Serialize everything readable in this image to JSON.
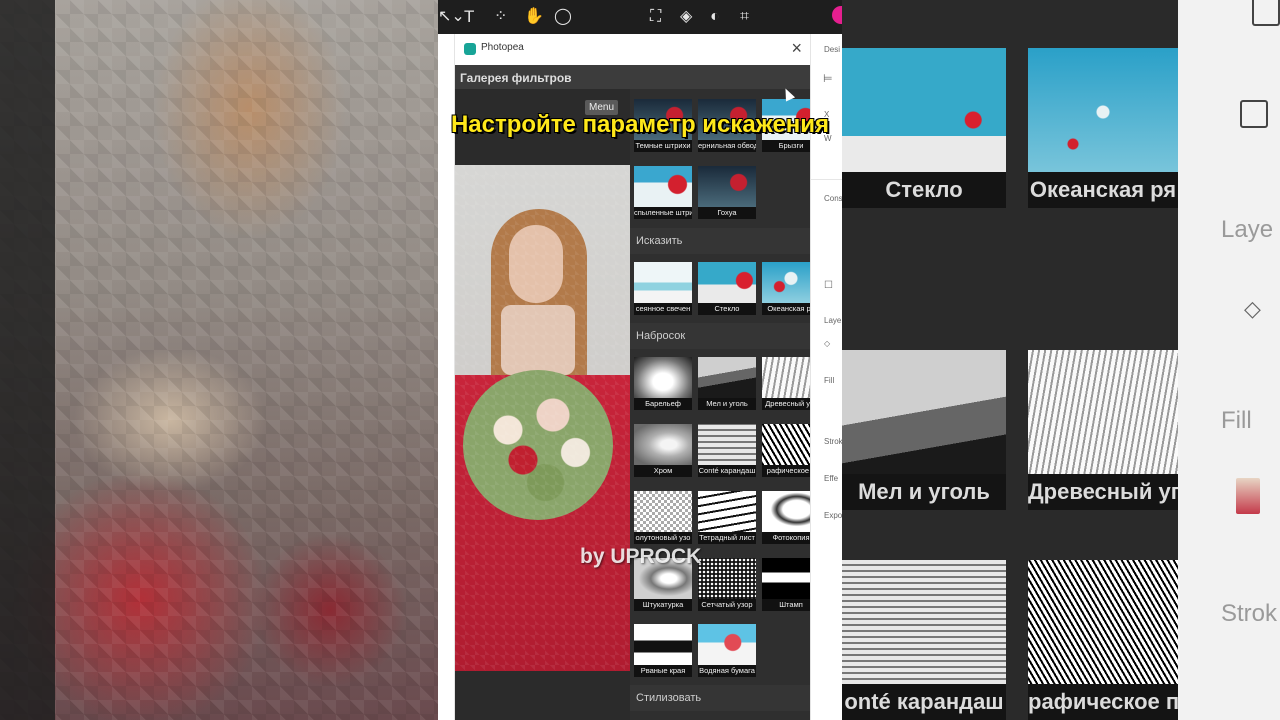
{
  "toolbar": {
    "icons": [
      "move-icon",
      "text-icon",
      "components-icon",
      "hand-icon",
      "comment-icon",
      "frame-icon",
      "component-icon",
      "contrast-icon",
      "crop-icon"
    ],
    "text_glyph": "T"
  },
  "photopea": {
    "title": "Photopea",
    "close": "×"
  },
  "gallery": {
    "title": "Галерея фильтров",
    "menu_label": "Menu",
    "sections": {
      "distort": "Исказить",
      "sketch": "Набросок",
      "stylize": "Стилизовать"
    },
    "filters_top": [
      "Темные штрихи",
      "ернильная обвод",
      "Брызги",
      "спыленные штри",
      "Гохуа"
    ],
    "filters_distort": [
      "сеянное свечен",
      "Стекло",
      "Океанская ря"
    ],
    "filters_sketch": [
      "Барельеф",
      "Мел и уголь",
      "Древесный уго",
      "Хром",
      "Conté карандаш",
      "рафическое п",
      "олутоновый узо",
      "Тетрадный лист",
      "Фотокопия",
      "Штукатурка",
      "Сетчатый узор",
      "Штамп",
      "Рваные края",
      "Водяная бумага"
    ]
  },
  "overlay": {
    "caption": "Настройте параметр искажения",
    "watermark": "by UPROCK"
  },
  "right_bg": {
    "labels": [
      "Стекло",
      "Океанская ря",
      "Мел и уголь",
      "Древесный уг",
      "onté карандаш",
      "рафическое п"
    ],
    "panel_labels": [
      "Laye",
      "Fill",
      "Strok"
    ]
  },
  "right_panel": {
    "labels": [
      "Desi",
      "X",
      "W",
      "Cons",
      "Laye",
      "Fill",
      "Strok",
      "Effe",
      "Expo"
    ]
  }
}
